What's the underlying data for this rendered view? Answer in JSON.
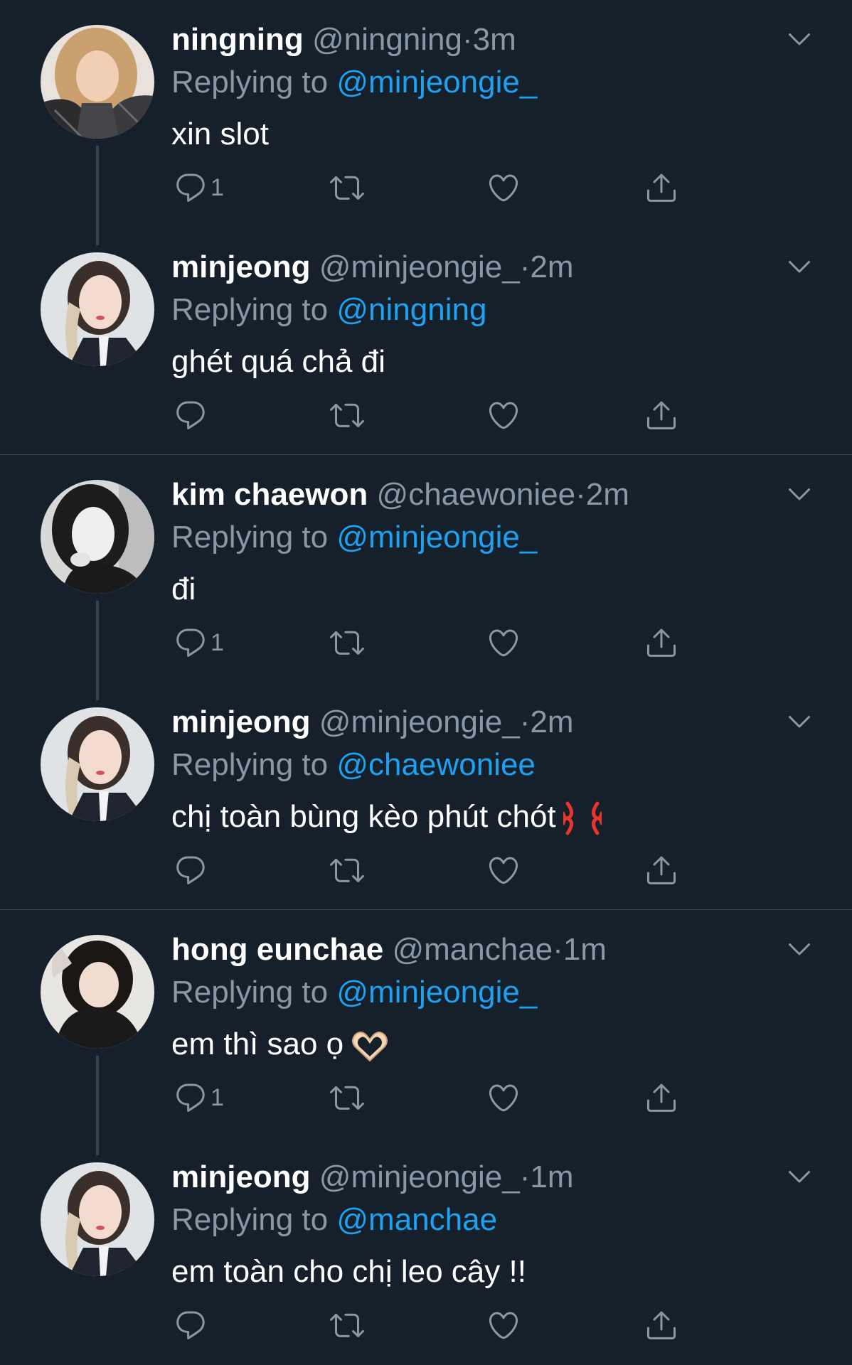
{
  "colors": {
    "background": "#15202b",
    "secondary_text": "#8899a6",
    "link": "#1da1f2",
    "divider": "#38444d"
  },
  "tweets": [
    {
      "name": "ningning",
      "handle": "@ningning",
      "dot": "·",
      "time": "3m",
      "replying_label": "Replying to",
      "replying_to": "@minjeongie_",
      "text": "xin slot",
      "reply_count": "1",
      "avatar": "avatar-blonde-hair"
    },
    {
      "name": "minjeong",
      "handle": "@minjeongie_",
      "dot": "·",
      "time": "2m",
      "replying_label": "Replying to",
      "replying_to": "@ningning",
      "text": "ghét quá chả đi",
      "reply_count": "",
      "avatar": "avatar-braided-hair"
    },
    {
      "name": "kim chaewon",
      "handle": "@chaewoniee",
      "dot": "·",
      "time": "2m",
      "replying_label": "Replying to",
      "replying_to": "@minjeongie_",
      "text": "đi",
      "reply_count": "1",
      "avatar": "avatar-monochrome"
    },
    {
      "name": "minjeong",
      "handle": "@minjeongie_",
      "dot": "·",
      "time": "2m",
      "replying_label": "Replying to",
      "replying_to": "@chaewoniee",
      "text": "chị toàn bùng kèo phút chót",
      "emoji": "anger-symbol",
      "reply_count": "",
      "avatar": "avatar-braided-hair"
    },
    {
      "name": "hong eunchae",
      "handle": "@manchae",
      "dot": "·",
      "time": "1m",
      "replying_label": "Replying to",
      "replying_to": "@minjeongie_",
      "text": "em thì sao ọ",
      "emoji": "heart-hands",
      "reply_count": "1",
      "avatar": "avatar-dark-hair"
    },
    {
      "name": "minjeong",
      "handle": "@minjeongie_",
      "dot": "·",
      "time": "1m",
      "replying_label": "Replying to",
      "replying_to": "@manchae",
      "text": "em toàn cho chị leo cây !!",
      "reply_count": "",
      "avatar": "avatar-braided-hair"
    }
  ],
  "icons": {
    "more": "chevron-down-icon",
    "reply": "reply-icon",
    "retweet": "retweet-icon",
    "like": "heart-icon",
    "share": "share-icon"
  }
}
